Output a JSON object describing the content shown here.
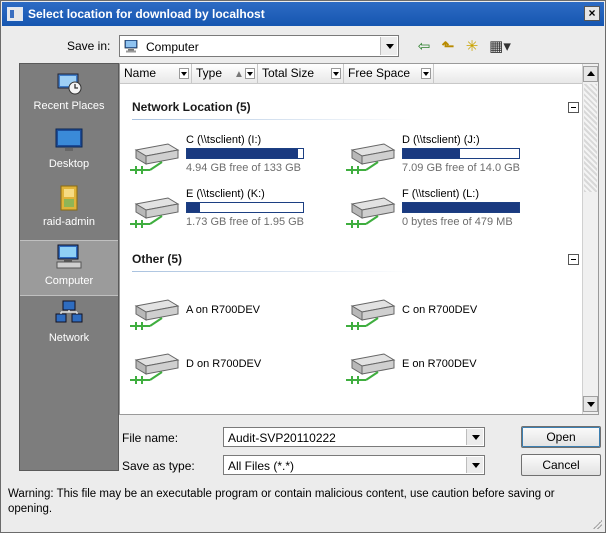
{
  "window": {
    "title": "Select location for download by localhost",
    "close_glyph": "×"
  },
  "save_in": {
    "label": "Save in:",
    "value": "Computer",
    "icon": "computer-icon"
  },
  "toolbar": {
    "back_glyph": "⇦",
    "up_glyph": "⬑",
    "new_folder_glyph": "✳",
    "views_glyph": "▦▾"
  },
  "places": [
    {
      "label": "Recent Places",
      "icon": "recent-places-icon"
    },
    {
      "label": "Desktop",
      "icon": "desktop-icon"
    },
    {
      "label": "raid-admin",
      "icon": "user-folder-icon"
    },
    {
      "label": "Computer",
      "icon": "computer-icon",
      "selected": true
    },
    {
      "label": "Network",
      "icon": "network-icon"
    }
  ],
  "columns": [
    {
      "label": "Name"
    },
    {
      "label": "Type"
    },
    {
      "label": "Total Size"
    },
    {
      "label": "Free Space"
    }
  ],
  "groups": {
    "network": {
      "title": "Network Location (5)",
      "drives": [
        {
          "name": "C (\\\\tsclient) (I:)",
          "free_text": "4.94 GB free of 133 GB",
          "used_fraction": 0.96
        },
        {
          "name": "D (\\\\tsclient) (J:)",
          "free_text": "7.09 GB free of 14.0 GB",
          "used_fraction": 0.49
        },
        {
          "name": "E (\\\\tsclient) (K:)",
          "free_text": "1.73 GB free of 1.95 GB",
          "used_fraction": 0.11
        },
        {
          "name": "F (\\\\tsclient) (L:)",
          "free_text": "0 bytes free of 479 MB",
          "used_fraction": 1.0
        }
      ]
    },
    "other": {
      "title": "Other (5)",
      "drives": [
        {
          "name": "A on R700DEV"
        },
        {
          "name": "C on R700DEV"
        },
        {
          "name": "D on R700DEV"
        },
        {
          "name": "E on R700DEV"
        }
      ]
    }
  },
  "form": {
    "file_name_label": "File name:",
    "file_name_value": "Audit-SVP20110222",
    "save_as_label": "Save as type:",
    "save_as_value": "All Files (*.*)",
    "open_label": "Open",
    "cancel_label": "Cancel"
  },
  "warning": "Warning: This file may be an executable program or contain malicious content, use caution before saving or opening.",
  "colors": {
    "titlebar": "#1656b0",
    "places_bg": "#7d7d7d",
    "drive_bar": "#1a3a80"
  }
}
